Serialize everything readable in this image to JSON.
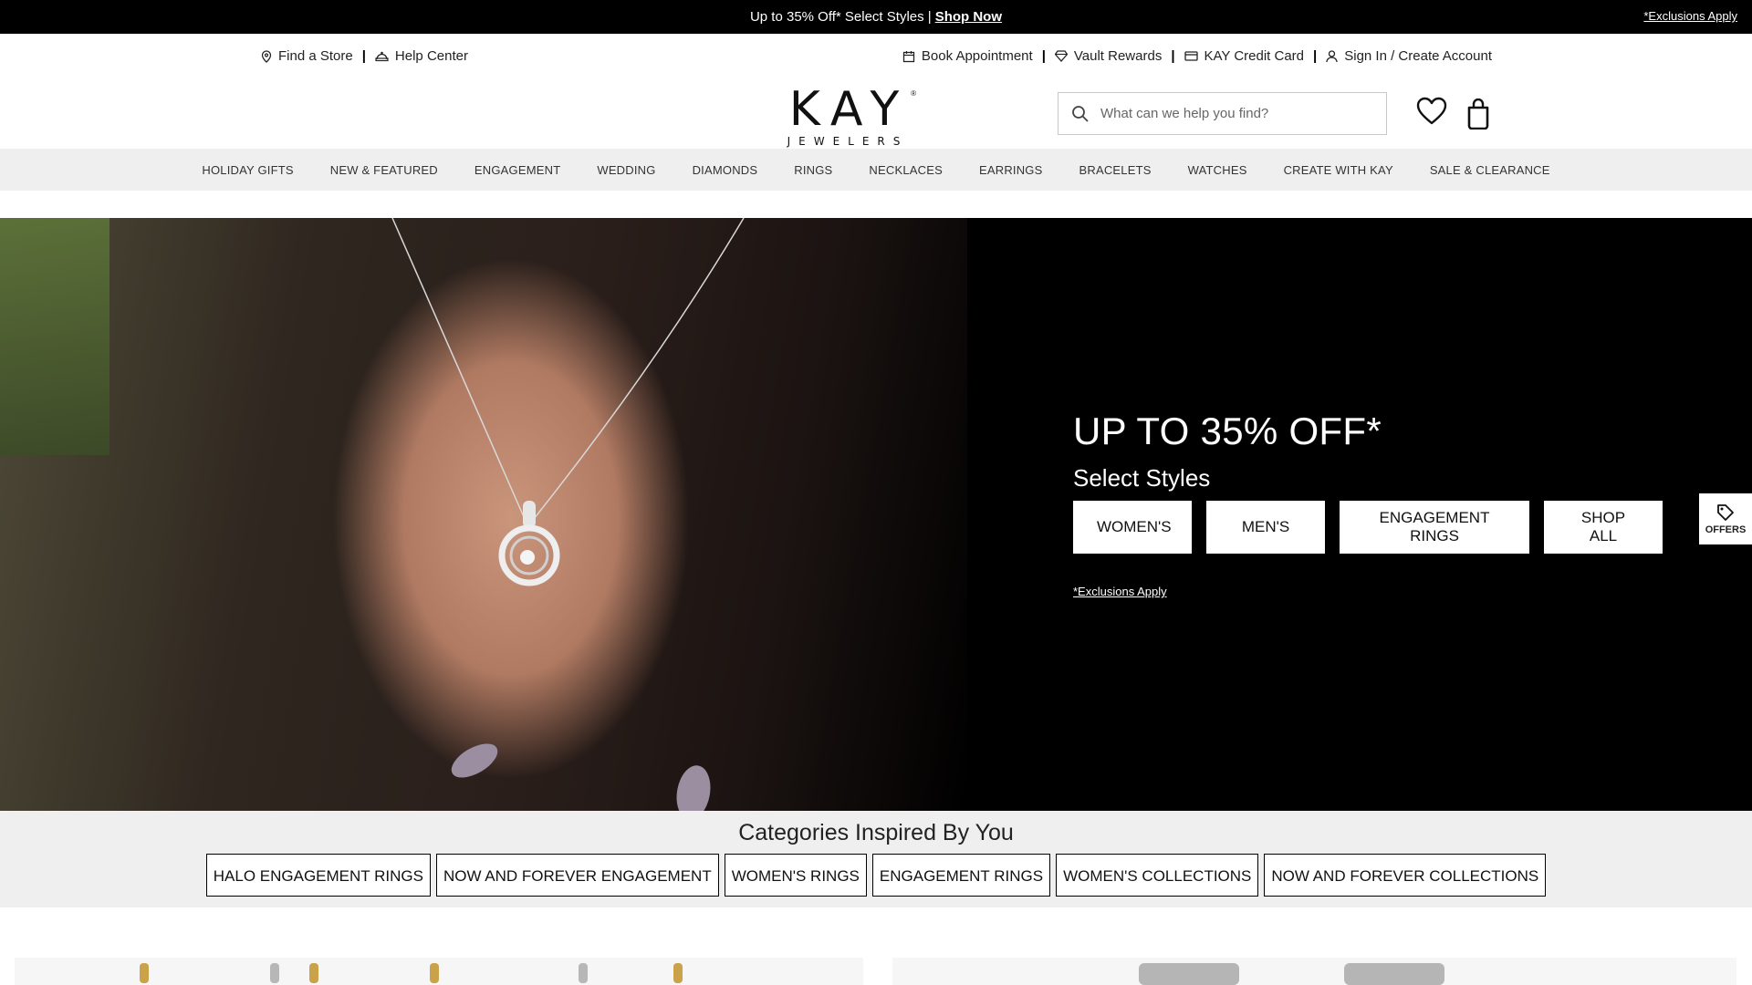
{
  "promo": {
    "text": "Up to 35% Off* Select Styles |",
    "link": "Shop Now",
    "exclusions": "*Exclusions Apply"
  },
  "utility": {
    "find_store": "Find a Store",
    "help_center": "Help Center",
    "book_appointment": "Book Appointment",
    "vault_rewards": "Vault Rewards",
    "credit_card": "KAY Credit Card",
    "sign_in": "Sign In / Create Account"
  },
  "logo": {
    "main": "KAY",
    "sub": "JEWELERS",
    "reg": "®"
  },
  "search": {
    "placeholder": "What can we help you find?"
  },
  "nav": {
    "items": [
      "HOLIDAY GIFTS",
      "NEW & FEATURED",
      "ENGAGEMENT",
      "WEDDING",
      "DIAMONDS",
      "RINGS",
      "NECKLACES",
      "EARRINGS",
      "BRACELETS",
      "WATCHES",
      "CREATE WITH KAY",
      "SALE & CLEARANCE"
    ]
  },
  "hero": {
    "title": "UP TO 35% OFF*",
    "subtitle": "Select Styles",
    "buttons": [
      "WOMEN'S",
      "MEN'S",
      "ENGAGEMENT RINGS",
      "SHOP ALL"
    ],
    "exclusions": "*Exclusions Apply"
  },
  "offers": {
    "label": "OFFERS"
  },
  "categories": {
    "title": "Categories Inspired By You",
    "chips": [
      "HALO ENGAGEMENT RINGS",
      "NOW AND FOREVER ENGAGEMENT",
      "WOMEN'S RINGS",
      "ENGAGEMENT RINGS",
      "WOMEN'S COLLECTIONS",
      "NOW AND FOREVER COLLECTIONS"
    ]
  },
  "colors": {
    "promo_bg": "#000000",
    "nav_bg": "#efefef",
    "hero_bg": "#000000",
    "categories_bg": "#efefef"
  },
  "icons": [
    "map-pin-icon",
    "help-icon",
    "calendar-icon",
    "vault-icon",
    "credit-card-icon",
    "user-icon",
    "search-icon",
    "heart-icon",
    "shopping-bag-icon",
    "tag-icon"
  ]
}
